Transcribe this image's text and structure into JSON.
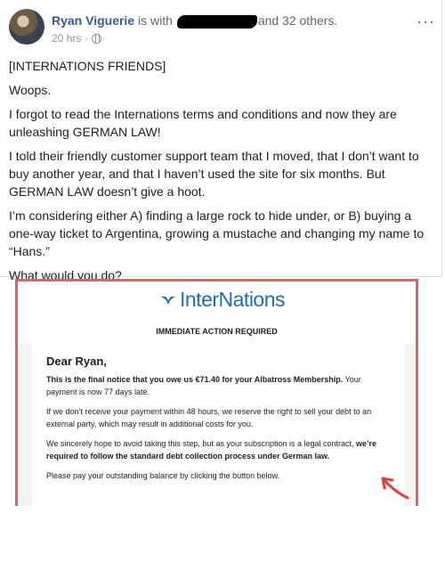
{
  "post": {
    "author": "Ryan Viguerie",
    "with_text": " is with ",
    "others_text": "and 32 others.",
    "time": "20 hrs",
    "dot": "·",
    "more": "···",
    "paragraphs": [
      "[INTERNATIONS FRIENDS]",
      "Woops.",
      "I forgot to read the Internations terms and conditions and now they are unleashing GERMAN LAW!",
      "I told their friendly customer support team that I moved, that I don’t want to buy another year, and that I haven’t used the site for six months. But GERMAN LAW doesn’t give a hoot.",
      "I’m considering either A) finding a large rock to hide under, or B) buying a one-way ticket to Argentina, growing a mustache and changing my name to “Hans.”",
      "What would you do?"
    ]
  },
  "email": {
    "brand": "InterNations",
    "banner": "IMMEDIATE ACTION REQUIRED",
    "greeting": "Dear Ryan,",
    "p1_bold": "This is the final notice that you owe us €71.40 for your Albatross Membership.",
    "p1_rest": " Your payment is now 77 days late.",
    "p2": "If we don’t receive your payment within 48 hours, we reserve the right to sell your debt to an external party, which may result in additional costs for you.",
    "p3_start": "We sincerely hope to avoid taking this step, but as your subscription is a legal contract, ",
    "p3_bold": "we’re required to follow the standard debt collection process under German law.",
    "p4": "Please pay your outstanding balance by clicking the button below."
  },
  "colors": {
    "name_link": "#385898",
    "brand_blue": "#1f6fae",
    "highlight_border": "#e5625f",
    "arrow": "#d9463e"
  },
  "icons": [
    "avatar",
    "globe-icon",
    "more-options-icon",
    "internations-logo-icon",
    "red-arrow-annotation"
  ]
}
